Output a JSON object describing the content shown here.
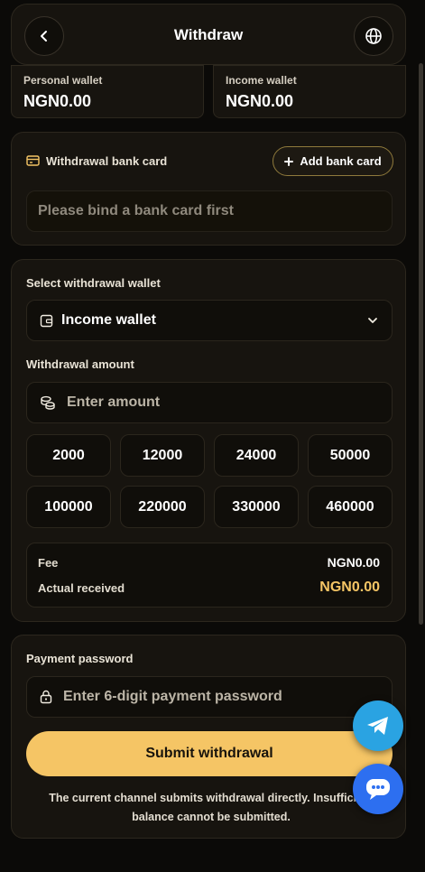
{
  "header": {
    "title": "Withdraw"
  },
  "wallets": {
    "personal": {
      "label": "Personal wallet",
      "value": "NGN0.00"
    },
    "income": {
      "label": "Income wallet",
      "value": "NGN0.00"
    }
  },
  "bank": {
    "title": "Withdrawal bank card",
    "add_label": "Add bank card",
    "placeholder": "Please bind a bank card first"
  },
  "form": {
    "select_wallet_label": "Select withdrawal wallet",
    "selected_wallet": "Income wallet",
    "amount_label": "Withdrawal amount",
    "amount_placeholder": "Enter amount",
    "presets": [
      "2000",
      "12000",
      "24000",
      "50000",
      "100000",
      "220000",
      "330000",
      "460000"
    ],
    "fee_label": "Fee",
    "fee_value": "NGN0.00",
    "received_label": "Actual received",
    "received_value": "NGN0.00"
  },
  "password": {
    "label": "Payment password",
    "placeholder": "Enter 6-digit payment password",
    "submit_label": "Submit withdrawal",
    "notice": "The current channel submits withdrawal directly. Insufficient balance cannot be submitted."
  },
  "colors": {
    "accent": "#f5c565",
    "background": "#0b0a08",
    "card": "#17140f",
    "telegram": "#2aa3e2",
    "chat": "#2d6ff0"
  }
}
